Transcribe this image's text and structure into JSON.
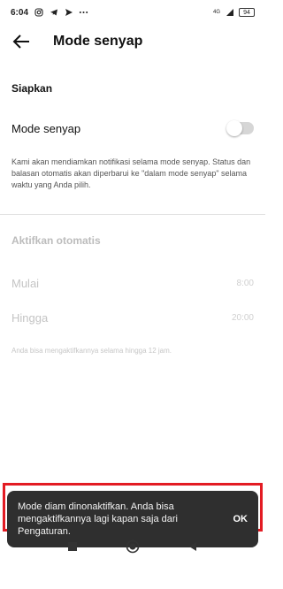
{
  "status_bar": {
    "time": "6:04",
    "icons": [
      "instagram-icon",
      "telegram-icon",
      "send-icon",
      "more-dots-icon"
    ],
    "network": "4G",
    "battery": "94"
  },
  "app_bar": {
    "title": "Mode senyap",
    "back_icon": "arrow-left-icon"
  },
  "setup": {
    "header": "Siapkan",
    "toggle_label": "Mode senyap",
    "toggle_on": false,
    "description": "Kami akan mendiamkan notifikasi selama mode senyap. Status dan balasan otomatis akan diperbarui ke \"dalam mode senyap\" selama waktu yang Anda pilih."
  },
  "auto": {
    "header": "Aktifkan otomatis",
    "start_label": "Mulai",
    "start_value": "8:00",
    "end_label": "Hingga",
    "end_value": "20:00",
    "note": "Anda bisa mengaktifkannya selama hingga 12 jam."
  },
  "snackbar": {
    "message": "Mode diam dinonaktifkan. Anda bisa mengaktifkannya lagi kapan saja dari Pengaturan.",
    "action": "OK"
  },
  "nav": {
    "items": [
      "recents-square-icon",
      "home-circle-icon",
      "back-triangle-icon"
    ]
  },
  "colors": {
    "highlight_frame": "#e31b23",
    "snackbar_bg": "#2f2f2f",
    "toggle_track_off": "#d6d6d6"
  }
}
